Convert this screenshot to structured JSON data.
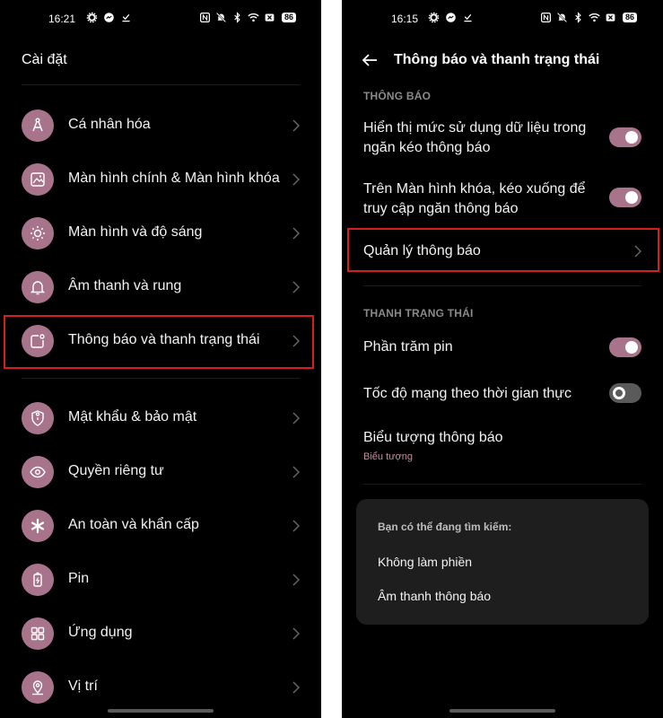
{
  "left": {
    "status": {
      "time": "16:21",
      "battery": "86"
    },
    "title": "Cài đặt",
    "items": [
      {
        "label": "Cá nhân hóa",
        "icon": "personalization-icon"
      },
      {
        "label": "Màn hình chính & Màn hình khóa",
        "icon": "image-icon"
      },
      {
        "label": "Màn hình và độ sáng",
        "icon": "brightness-icon"
      },
      {
        "label": "Âm thanh và rung",
        "icon": "bell-icon"
      },
      {
        "label": "Thông báo và thanh trạng thái",
        "icon": "notification-icon"
      },
      {
        "label": "Mật khẩu & bảo mật",
        "icon": "shield-icon"
      },
      {
        "label": "Quyền riêng tư",
        "icon": "privacy-eye-icon"
      },
      {
        "label": "An toàn và khẩn cấp",
        "icon": "emergency-icon"
      },
      {
        "label": "Pin",
        "icon": "battery-icon"
      },
      {
        "label": "Ứng dụng",
        "icon": "apps-grid-icon"
      },
      {
        "label": "Vị trí",
        "icon": "location-icon"
      }
    ]
  },
  "right": {
    "status": {
      "time": "16:15",
      "battery": "86"
    },
    "title": "Thông báo và thanh trạng thái",
    "section_notifications": "THÔNG BÁO",
    "row_data_usage": {
      "line1": "Hiển thị mức sử dụng dữ liệu trong",
      "line2": "ngăn kéo thông báo",
      "enabled": true
    },
    "row_lockscreen": {
      "line1": "Trên Màn hình khóa, kéo xuống để",
      "line2": "truy cập ngăn thông báo",
      "enabled": true
    },
    "row_manage": "Quản lý thông báo",
    "section_statusbar": "THANH TRẠNG THÁI",
    "row_battery_percent": {
      "label": "Phần trăm pin",
      "enabled": true
    },
    "row_network_speed": {
      "label": "Tốc độ mạng theo thời gian thực",
      "enabled": false
    },
    "row_icons": {
      "label": "Biểu tượng thông báo",
      "sub": "Biểu tượng"
    },
    "suggest": {
      "title": "Bạn có thể đang tìm kiếm:",
      "items": [
        "Không làm phiền",
        "Âm thanh thông báo"
      ]
    }
  },
  "colors": {
    "accent": "#a8748c",
    "highlight": "#d21f1f",
    "background": "#000000"
  }
}
